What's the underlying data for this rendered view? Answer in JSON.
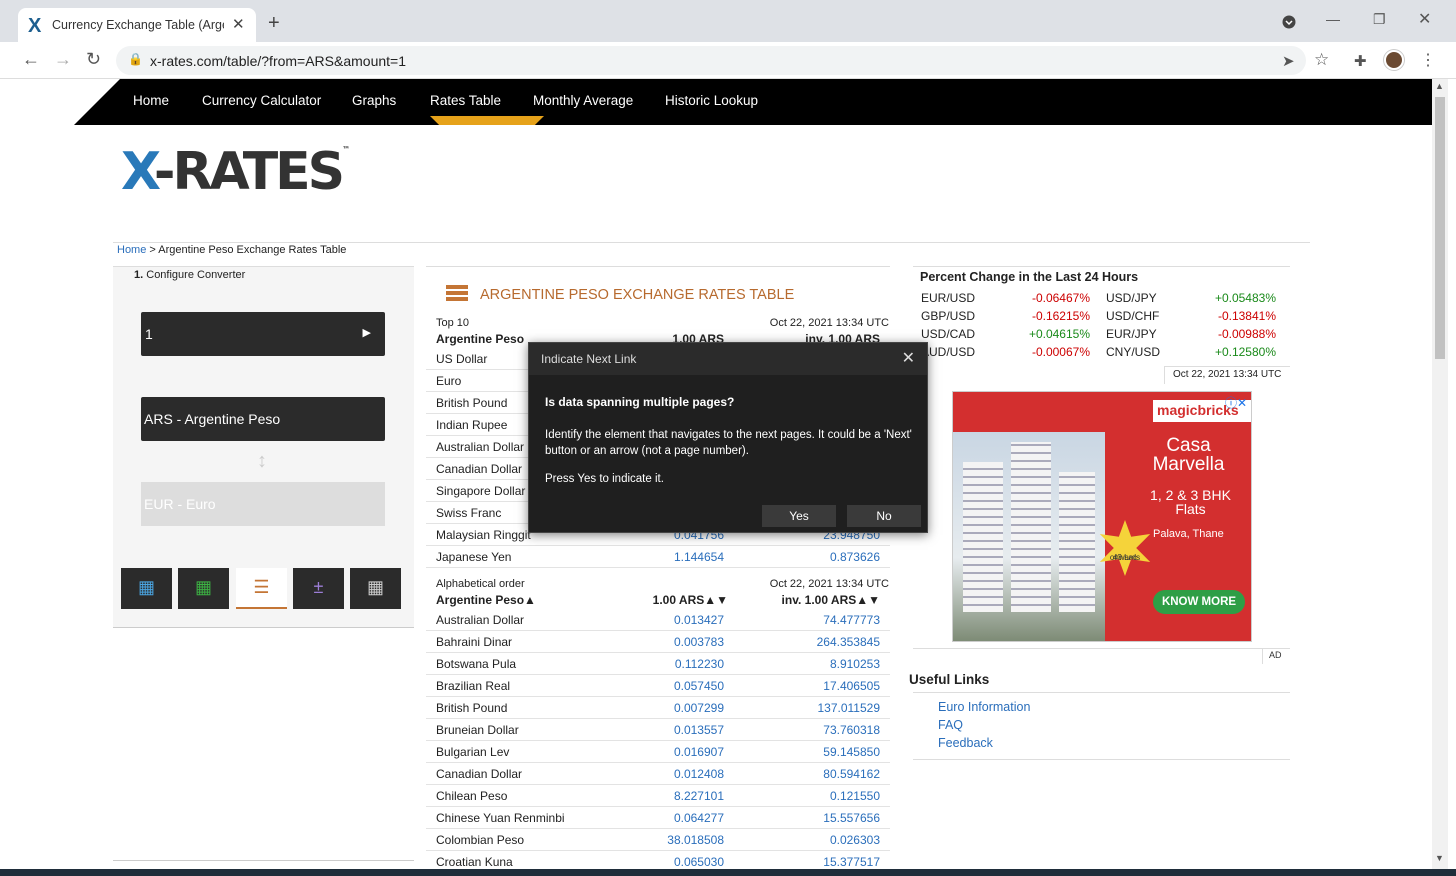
{
  "browser": {
    "tab_title": "Currency Exchange Table (Argent",
    "tab_close": "✕",
    "new_tab": "+",
    "url": "x-rates.com/table/?from=ARS&amount=1"
  },
  "nav": {
    "items": [
      "Home",
      "Currency Calculator",
      "Graphs",
      "Rates Table",
      "Monthly Average",
      "Historic Lookup"
    ],
    "active": "Rates Table",
    "accent_color": "#e6a21a"
  },
  "logo": {
    "x": "X",
    "rest": "-RATES",
    "tm": "™"
  },
  "breadcrumb": {
    "home": "Home",
    "sep": " > ",
    "current": "Argentine Peso Exchange Rates Table"
  },
  "converter": {
    "step": "1.",
    "step_label": "Configure Converter",
    "amount": "1",
    "from": "ARS - Argentine Peso",
    "to": "EUR - Euro"
  },
  "table": {
    "title": "ARGENTINE PESO EXCHANGE RATES TABLE",
    "top_label": "Top 10",
    "date": "Oct 22, 2021 13:34 UTC",
    "base": "Argentine Peso",
    "col1": "1.00 ARS",
    "col2": "inv. 1.00 ARS",
    "top_rows": [
      {
        "name": "US Dollar",
        "a": "",
        "b": ""
      },
      {
        "name": "Euro",
        "a": "",
        "b": ""
      },
      {
        "name": "British Pound",
        "a": "",
        "b": ""
      },
      {
        "name": "Indian Rupee",
        "a": "",
        "b": ""
      },
      {
        "name": "Australian Dollar",
        "a": "",
        "b": ""
      },
      {
        "name": "Canadian Dollar",
        "a": "",
        "b": ""
      },
      {
        "name": "Singapore Dollar",
        "a": "",
        "b": ""
      },
      {
        "name": "Swiss Franc",
        "a": "",
        "b": ""
      },
      {
        "name": "Malaysian Ringgit",
        "a": "0.041756",
        "b": "23.948750"
      },
      {
        "name": "Japanese Yen",
        "a": "1.144654",
        "b": "0.873626"
      }
    ],
    "alpha_label": "Alphabetical order",
    "alpha_base": "Argentine Peso▲",
    "alpha_col1": "1.00 ARS▲▼",
    "alpha_col2": "inv. 1.00 ARS▲▼",
    "alpha_rows": [
      {
        "name": "Australian Dollar",
        "a": "0.013427",
        "b": "74.477773"
      },
      {
        "name": "Bahraini Dinar",
        "a": "0.003783",
        "b": "264.353845"
      },
      {
        "name": "Botswana Pula",
        "a": "0.112230",
        "b": "8.910253"
      },
      {
        "name": "Brazilian Real",
        "a": "0.057450",
        "b": "17.406505"
      },
      {
        "name": "British Pound",
        "a": "0.007299",
        "b": "137.011529"
      },
      {
        "name": "Bruneian Dollar",
        "a": "0.013557",
        "b": "73.760318"
      },
      {
        "name": "Bulgarian Lev",
        "a": "0.016907",
        "b": "59.145850"
      },
      {
        "name": "Canadian Dollar",
        "a": "0.012408",
        "b": "80.594162"
      },
      {
        "name": "Chilean Peso",
        "a": "8.227101",
        "b": "0.121550"
      },
      {
        "name": "Chinese Yuan Renminbi",
        "a": "0.064277",
        "b": "15.557656"
      },
      {
        "name": "Colombian Peso",
        "a": "38.018508",
        "b": "0.026303"
      },
      {
        "name": "Croatian Kuna",
        "a": "0.065030",
        "b": "15.377517"
      }
    ]
  },
  "pct": {
    "title": "Percent Change in the Last 24 Hours",
    "left": [
      {
        "pair": "EUR/USD",
        "val": "-0.06467%"
      },
      {
        "pair": "GBP/USD",
        "val": "-0.16215%"
      },
      {
        "pair": "USD/CAD",
        "val": "+0.04615%"
      },
      {
        "pair": "AUD/USD",
        "val": "-0.00067%"
      }
    ],
    "right": [
      {
        "pair": "USD/JPY",
        "val": "+0.05483%"
      },
      {
        "pair": "USD/CHF",
        "val": "-0.13841%"
      },
      {
        "pair": "EUR/JPY",
        "val": "-0.00988%"
      },
      {
        "pair": "CNY/USD",
        "val": "+0.12580%"
      }
    ],
    "date": "Oct 22, 2021 13:34 UTC"
  },
  "ad": {
    "brand": "magicbricks",
    "title_line1": "Casa",
    "title_line2": "Marvella",
    "sub_line1": "1, 2 & 3 BHK",
    "sub_line2": "Flats",
    "badge_line1": "43 Lac",
    "badge_line2": "onwards",
    "location": "Palava, Thane",
    "cta": "KNOW MORE",
    "label": "AD"
  },
  "useful": {
    "title": "Useful Links",
    "links": [
      "Euro Information",
      "FAQ",
      "Feedback"
    ]
  },
  "dialog": {
    "title": "Indicate Next Link",
    "question": "Is data spanning multiple pages?",
    "body": "Identify the element that navigates to the next pages. It could be a 'Next' button or an arrow (not a page number).",
    "prompt": "Press Yes to indicate it.",
    "yes": "Yes",
    "no": "No"
  }
}
